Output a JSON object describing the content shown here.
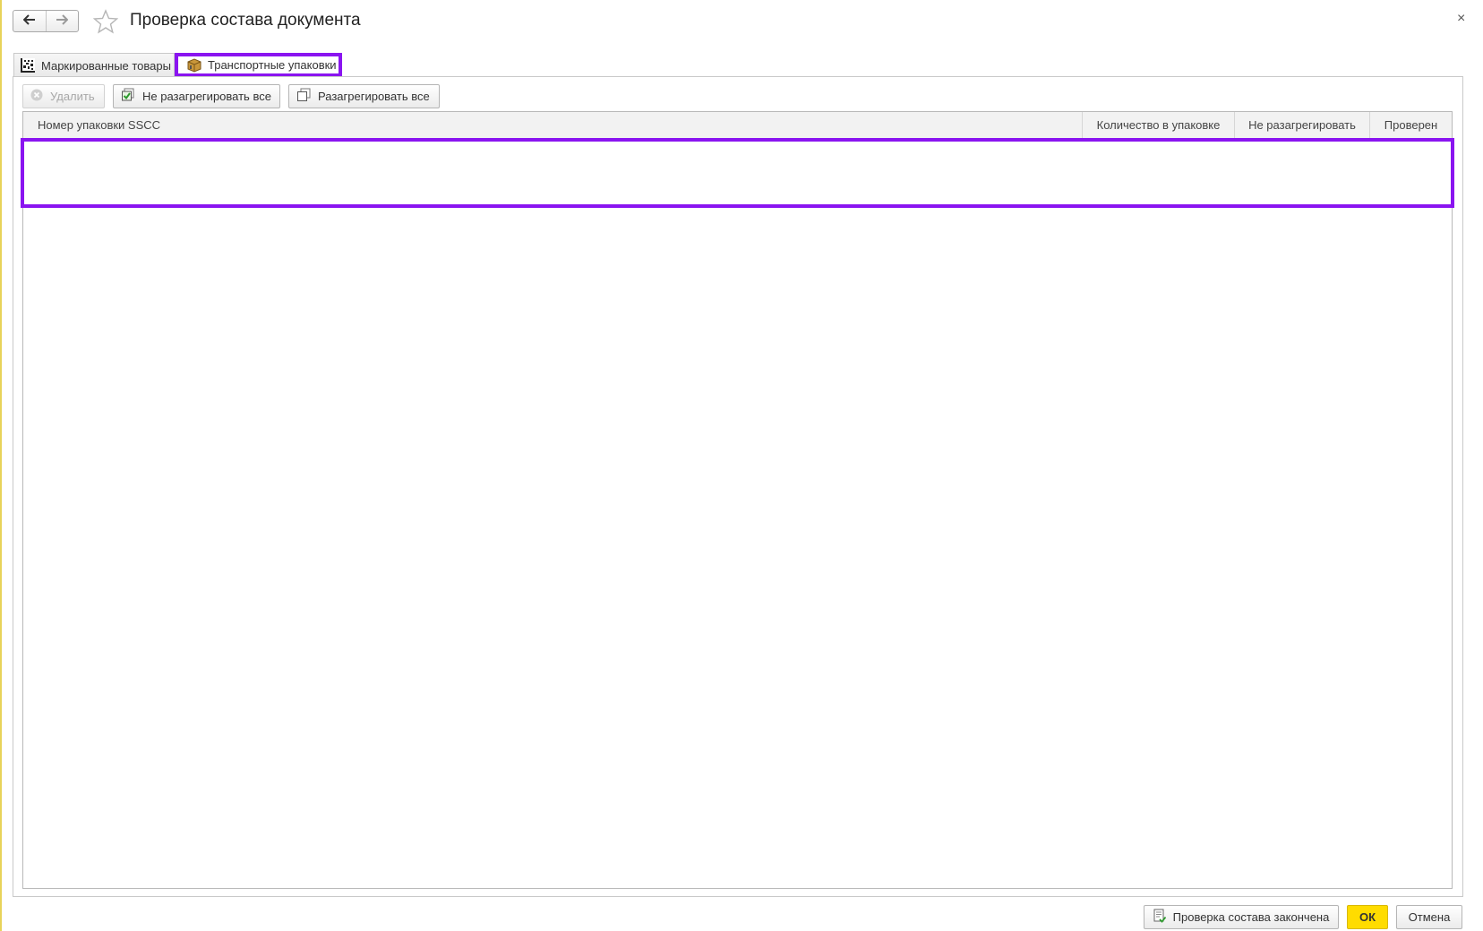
{
  "window": {
    "title": "Проверка состава документа",
    "close_glyph": "×",
    "nav_back_glyph": "🡐",
    "nav_forward_glyph": "🡒"
  },
  "tabs": [
    {
      "label": "Маркированные товары",
      "icon": "datamatrix-icon",
      "active": false
    },
    {
      "label": "Транспортные упаковки",
      "icon": "package-box-icon",
      "active": true
    }
  ],
  "toolbar": {
    "delete_label": "Удалить",
    "keep_all_label": "Не разагрегировать все",
    "unaggregate_all_label": "Разагрегировать все"
  },
  "table": {
    "columns": [
      "Номер упаковки SSCC",
      "Количество в упаковке",
      "Не разагрегировать",
      "Проверен"
    ],
    "rows": []
  },
  "footer": {
    "done_label": "Проверка состава закончена",
    "ok_label": "ОК",
    "cancel_label": "Отмена"
  },
  "colors": {
    "highlight": "#8a14f0",
    "ok_button": "#ffdc00"
  }
}
